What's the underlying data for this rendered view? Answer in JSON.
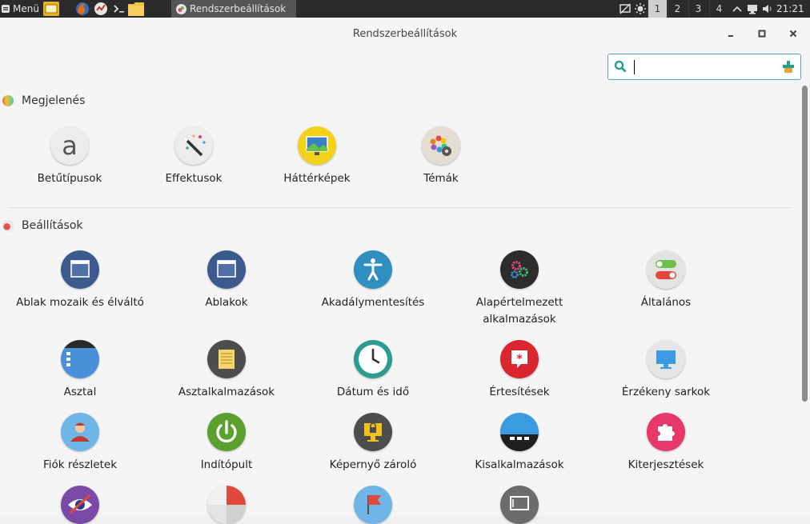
{
  "panel": {
    "menu_label": "Menü",
    "task_label": "Rendszerbeállítások",
    "workspaces": [
      "1",
      "2",
      "3",
      "4"
    ],
    "active_workspace": "1",
    "clock": "21:21"
  },
  "window": {
    "title": "Rendszerbeállítások",
    "search": {
      "value": "",
      "placeholder": ""
    }
  },
  "sections": {
    "appearance": {
      "title": "Megjelenés",
      "items": [
        {
          "label": "Betűtípusok",
          "icon": "font-icon"
        },
        {
          "label": "Effektusok",
          "icon": "effects-wand-icon"
        },
        {
          "label": "Háttérképek",
          "icon": "wallpaper-icon"
        },
        {
          "label": "Témák",
          "icon": "themes-icon"
        }
      ]
    },
    "settings": {
      "title": "Beállítások",
      "items": [
        {
          "label": "Ablak mozaik és élváltó",
          "icon": "window-tiling-icon"
        },
        {
          "label": "Ablakok",
          "icon": "windows-icon"
        },
        {
          "label": "Akadálymentesítés",
          "icon": "accessibility-icon"
        },
        {
          "label": "Alapértelmezett alkalmazások",
          "icon": "default-apps-icon"
        },
        {
          "label": "Általános",
          "icon": "general-toggles-icon"
        },
        {
          "label": "Asztal",
          "icon": "desktop-icon"
        },
        {
          "label": "Asztalkalmazások",
          "icon": "desklets-icon"
        },
        {
          "label": "Dátum és idő",
          "icon": "clock-icon"
        },
        {
          "label": "Értesítések",
          "icon": "notifications-icon"
        },
        {
          "label": "Érzékeny sarkok",
          "icon": "hot-corners-icon"
        },
        {
          "label": "Fiók részletek",
          "icon": "account-icon"
        },
        {
          "label": "Indítópult",
          "icon": "power-startup-icon"
        },
        {
          "label": "Képernyő zároló",
          "icon": "screen-lock-icon"
        },
        {
          "label": "Kisalkalmazások",
          "icon": "applets-icon"
        },
        {
          "label": "Kiterjesztések",
          "icon": "extensions-puzzle-icon"
        },
        {
          "label": "",
          "icon": "privacy-eye-icon"
        },
        {
          "label": "",
          "icon": "pie-chart-icon"
        },
        {
          "label": "",
          "icon": "flag-icon"
        },
        {
          "label": "",
          "icon": "screen-icon"
        }
      ]
    }
  },
  "colors": {
    "panel_bg": "#2b2b2b",
    "window_bg": "#f5f5f5",
    "search_border": "#5b9bd5",
    "accent_teal": "#2a9d8f"
  }
}
